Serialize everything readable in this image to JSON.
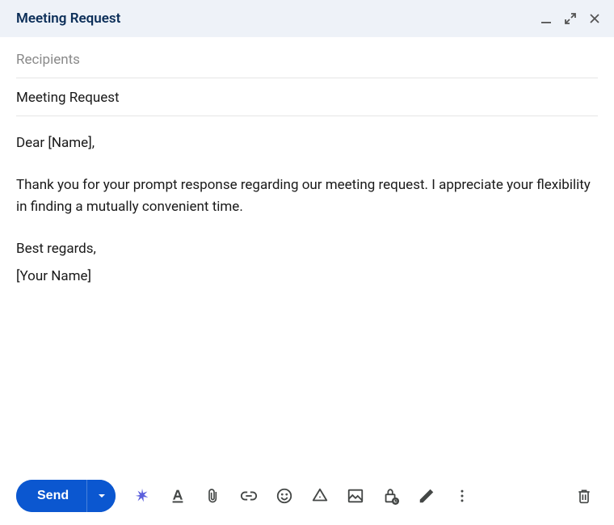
{
  "header": {
    "title": "Meeting Request"
  },
  "fields": {
    "recipients_placeholder": "Recipients",
    "subject": "Meeting Request"
  },
  "body": {
    "greeting": "Dear [Name],",
    "paragraph1": "Thank you for your prompt response regarding our meeting request. I appreciate your flexibility in finding a mutually convenient time.",
    "closing": "Best regards,",
    "signature": "[Your Name]"
  },
  "toolbar": {
    "send_label": "Send"
  },
  "icons": {
    "minimize": "minimize",
    "expand": "expand",
    "close": "close",
    "sparkle": "ai-sparkle",
    "format": "format-text",
    "attach": "attach",
    "link": "link",
    "emoji": "emoji",
    "drive": "drive",
    "image": "image",
    "confidential": "confidential-lock",
    "signature": "pen",
    "more": "more",
    "delete": "delete"
  }
}
